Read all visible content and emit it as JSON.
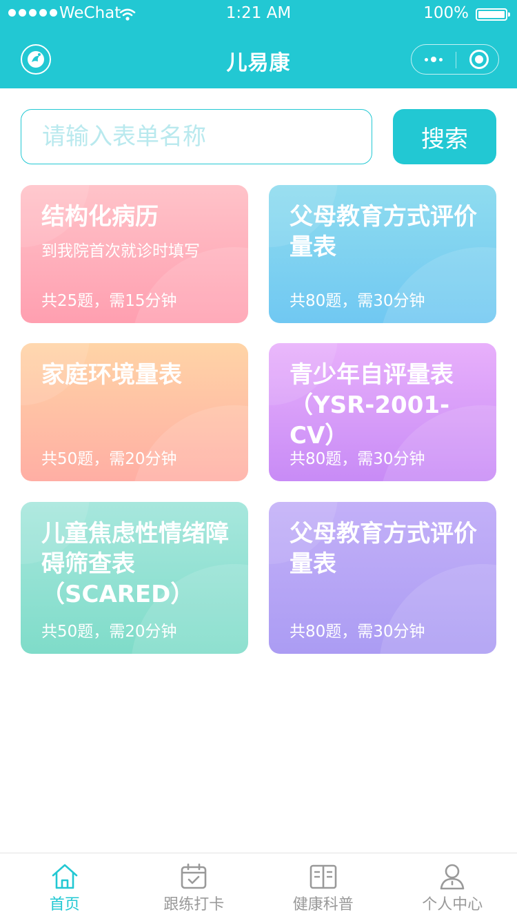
{
  "status_bar": {
    "carrier": "WeChat",
    "time": "1:21 AM",
    "battery": "100%"
  },
  "nav": {
    "title": "儿易康",
    "logo_icon": "app-logo-icon",
    "more_icon": "more-dots-icon",
    "close_icon": "close-target-icon"
  },
  "search": {
    "placeholder": "请输入表单名称",
    "value": "",
    "button_label": "搜索"
  },
  "colors": {
    "accent": "#22c8d3",
    "tab_inactive": "#999999"
  },
  "cards": [
    {
      "title": "结构化病历",
      "subtitle": "到我院首次就诊时填写",
      "meta": "共25题，需15分钟"
    },
    {
      "title": "父母教育方式评价量表",
      "subtitle": "",
      "meta": "共80题，需30分钟"
    },
    {
      "title": "家庭环境量表",
      "subtitle": "",
      "meta": "共50题，需20分钟"
    },
    {
      "title": "青少年自评量表（YSR-2001-CV）",
      "subtitle": "",
      "meta": "共80题，需30分钟"
    },
    {
      "title": "儿童焦虑性情绪障碍筛查表（SCARED）",
      "subtitle": "",
      "meta": "共50题，需20分钟"
    },
    {
      "title": "父母教育方式评价量表",
      "subtitle": "",
      "meta": "共80题，需30分钟"
    }
  ],
  "tabbar": [
    {
      "label": "首页",
      "icon": "home-icon",
      "active": true
    },
    {
      "label": "跟练打卡",
      "icon": "calendar-check-icon",
      "active": false
    },
    {
      "label": "健康科普",
      "icon": "book-icon",
      "active": false
    },
    {
      "label": "个人中心",
      "icon": "person-icon",
      "active": false
    }
  ]
}
